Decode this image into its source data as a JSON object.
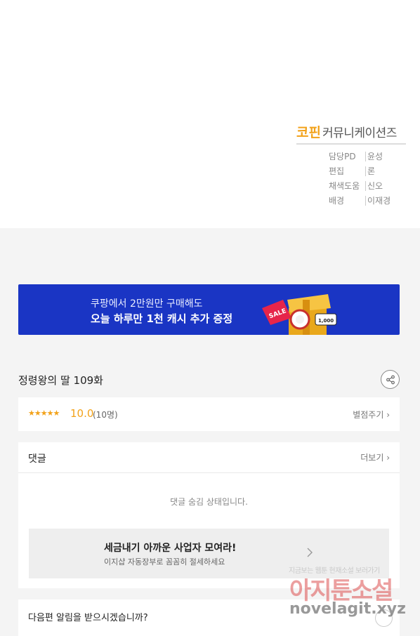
{
  "credits": {
    "logo_accent": "코핀",
    "logo_rest": "커뮤니케이션즈",
    "rows": [
      {
        "role": "담당PD",
        "name": "윤성"
      },
      {
        "role": "편집",
        "name": "론"
      },
      {
        "role": "채색도움",
        "name": "신오"
      },
      {
        "role": "배경",
        "name": "이재경"
      }
    ]
  },
  "banner": {
    "line1": "쿠팡에서 2만원만 구매해도",
    "line2": "오늘 하루만 1천 캐시 추가 증정",
    "art_sale": "SALE",
    "art_coin": "1,000",
    "bg_color": "#1a35c4"
  },
  "episode": {
    "title": "정령왕의 딸 109화",
    "share_icon": "share-icon"
  },
  "rating": {
    "stars": "★★★★★",
    "score": "10.0",
    "count": "(10명)",
    "rate_link": "별점주기 ›",
    "accent_color": "#f2a21a"
  },
  "comments": {
    "title": "댓글",
    "more_link": "더보기 ›",
    "hidden_message": "댓글 숨김 상태입니다.",
    "ad_title": "세금내기 아까운 사업자 모여라!",
    "ad_subtitle": "이지샵 자동장부로 꼼꼼히 절세하세요"
  },
  "notify": {
    "text": "다음편 알림을 받으시겠습니까?"
  },
  "watermark": {
    "line1": "지금보는 웹툰 현재소설 보러가기",
    "line2": "아지툰소설",
    "line3": "novelagit.xyz"
  }
}
